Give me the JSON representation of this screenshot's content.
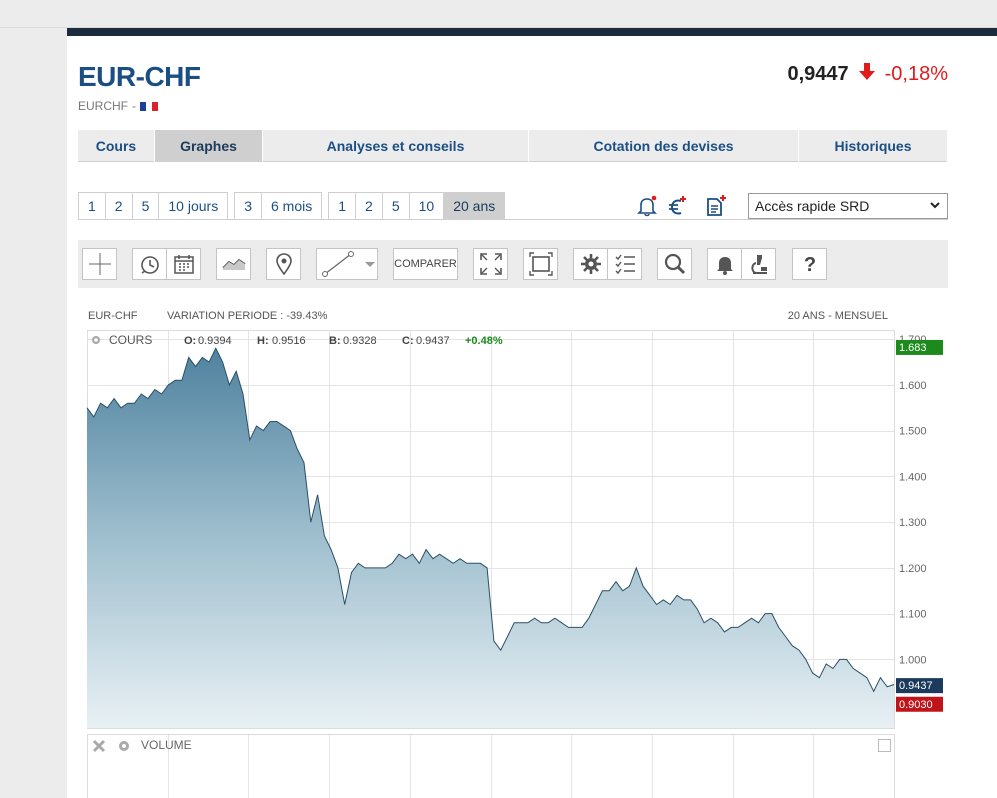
{
  "instrument": {
    "title": "EUR-CHF",
    "code": "EURCHF",
    "code_separator": "-",
    "price": "0,9447",
    "change": "-0,18%",
    "change_color": "#e01b1b"
  },
  "tabs": [
    {
      "label": "Cours"
    },
    {
      "label": "Graphes"
    },
    {
      "label": "Analyses et conseils"
    },
    {
      "label": "Cotation des devises"
    },
    {
      "label": "Historiques"
    }
  ],
  "periods": {
    "group_days": [
      "1",
      "2",
      "5",
      "10 jours"
    ],
    "group_months": [
      "3",
      "6 mois"
    ],
    "group_years": [
      "1",
      "2",
      "5",
      "10",
      "20 ans"
    ],
    "active": "20 ans"
  },
  "quick_access": {
    "label": "Accès rapide SRD"
  },
  "toolbar": {
    "compare_label": "COMPARER"
  },
  "chart_header": {
    "symbol": "EUR-CHF",
    "variation": "VARIATION PERIODE : -39.43%",
    "period": "20 ANS - MENSUEL"
  },
  "legend": {
    "series": "COURS",
    "o_label": "O:",
    "o_value": "0.9394",
    "h_label": "H:",
    "h_value": "0.9516",
    "b_label": "B:",
    "b_value": "0.9328",
    "c_label": "C:",
    "c_value": "0.9437",
    "change": "+0.48%",
    "volume": "VOLUME"
  },
  "chart_data": {
    "type": "area",
    "title": "",
    "ylim": [
      0.85,
      1.72
    ],
    "yticks": [
      "1.700",
      "1.600",
      "1.500",
      "1.400",
      "1.300",
      "1.200",
      "1.100",
      "1.000"
    ],
    "ytick_values": [
      1.7,
      1.6,
      1.5,
      1.4,
      1.3,
      1.2,
      1.1,
      1.0
    ],
    "badges": [
      {
        "label": "1.683",
        "value": 1.683,
        "color": "#1c8a1c"
      },
      {
        "label": "0.9437",
        "value": 0.9437,
        "color": "#1b3a5c"
      },
      {
        "label": "0.9030",
        "value": 0.903,
        "color": "#c0141b"
      }
    ],
    "x_index": [
      0,
      1,
      2,
      3,
      4,
      5,
      6,
      7,
      8,
      9,
      10,
      11,
      12,
      13,
      14,
      15,
      16,
      17,
      18,
      19,
      20,
      21,
      22,
      23,
      24,
      25,
      26,
      27,
      28,
      29,
      30,
      31,
      32,
      33,
      34,
      35,
      36,
      37,
      38,
      39,
      40,
      41,
      42,
      43,
      44,
      45,
      46,
      47,
      48,
      49,
      50,
      51,
      52,
      53,
      54,
      55,
      56,
      57,
      58,
      59,
      60,
      61,
      62,
      63,
      64,
      65,
      66,
      67,
      68,
      69,
      70,
      71,
      72,
      73,
      74,
      75,
      76,
      77,
      78,
      79,
      80,
      81,
      82,
      83,
      84,
      85,
      86,
      87,
      88,
      89,
      90,
      91,
      92,
      93,
      94,
      95,
      96,
      97,
      98,
      99,
      100,
      101,
      102,
      103,
      104,
      105,
      106,
      107,
      108,
      109,
      110,
      111,
      112,
      113,
      114,
      115,
      116,
      117,
      118,
      119
    ],
    "series": [
      {
        "values": [
          1.55,
          1.53,
          1.56,
          1.55,
          1.57,
          1.55,
          1.56,
          1.56,
          1.58,
          1.57,
          1.59,
          1.58,
          1.6,
          1.61,
          1.61,
          1.66,
          1.64,
          1.66,
          1.65,
          1.68,
          1.65,
          1.6,
          1.63,
          1.58,
          1.48,
          1.51,
          1.5,
          1.52,
          1.52,
          1.51,
          1.5,
          1.46,
          1.43,
          1.3,
          1.36,
          1.27,
          1.24,
          1.2,
          1.12,
          1.19,
          1.21,
          1.2,
          1.2,
          1.2,
          1.2,
          1.21,
          1.23,
          1.22,
          1.23,
          1.21,
          1.24,
          1.22,
          1.23,
          1.22,
          1.21,
          1.22,
          1.21,
          1.21,
          1.21,
          1.2,
          1.04,
          1.02,
          1.05,
          1.08,
          1.08,
          1.08,
          1.09,
          1.08,
          1.08,
          1.09,
          1.08,
          1.07,
          1.07,
          1.07,
          1.09,
          1.12,
          1.15,
          1.15,
          1.17,
          1.15,
          1.16,
          1.2,
          1.16,
          1.14,
          1.12,
          1.13,
          1.12,
          1.14,
          1.13,
          1.13,
          1.11,
          1.08,
          1.09,
          1.08,
          1.06,
          1.07,
          1.07,
          1.08,
          1.09,
          1.08,
          1.1,
          1.1,
          1.07,
          1.05,
          1.03,
          1.02,
          1.0,
          0.97,
          0.96,
          0.99,
          0.98,
          1.0,
          1.0,
          0.98,
          0.97,
          0.96,
          0.93,
          0.96,
          0.94,
          0.945
        ]
      }
    ]
  }
}
